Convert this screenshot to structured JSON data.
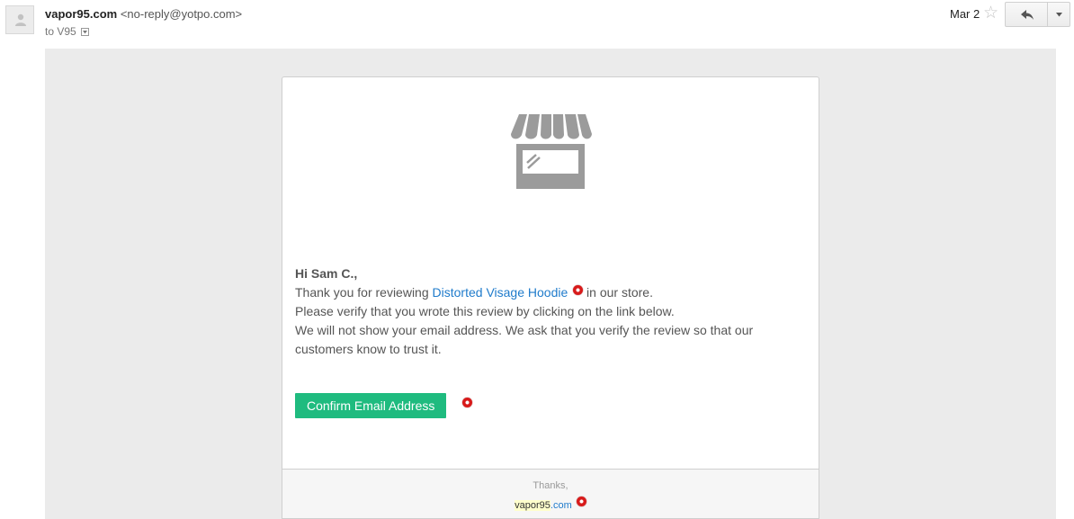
{
  "header": {
    "sender_name": "vapor95.com",
    "sender_address": "<no-reply@yotpo.com>",
    "to_label": "to V95",
    "date": "Mar 2"
  },
  "icons": {
    "avatar": "person-icon",
    "star": "star-icon",
    "reply": "reply-arrow-icon",
    "more": "caret-down-icon",
    "store": "storefront-icon",
    "link_marker": "red-dot-icon"
  },
  "email": {
    "greeting": "Hi Sam C.,",
    "line1_prefix": "Thank you for reviewing ",
    "product_link": "Distorted Visage Hoodie",
    "line1_suffix": " in our store.",
    "line2": "Please verify that you wrote this review by clicking on the link below.",
    "line3": "We will not show your email address. We ask that you verify the review so that our customers know to trust it.",
    "confirm_button": "Confirm Email Address",
    "footer_thanks": "Thanks,",
    "footer_site_name": "vapor95",
    "footer_site_tld": ".com"
  },
  "colors": {
    "link": "#1f7bcb",
    "button": "#1fbb7f",
    "mail_background": "#ebebeb",
    "logo_gray": "#9b9b9b"
  }
}
